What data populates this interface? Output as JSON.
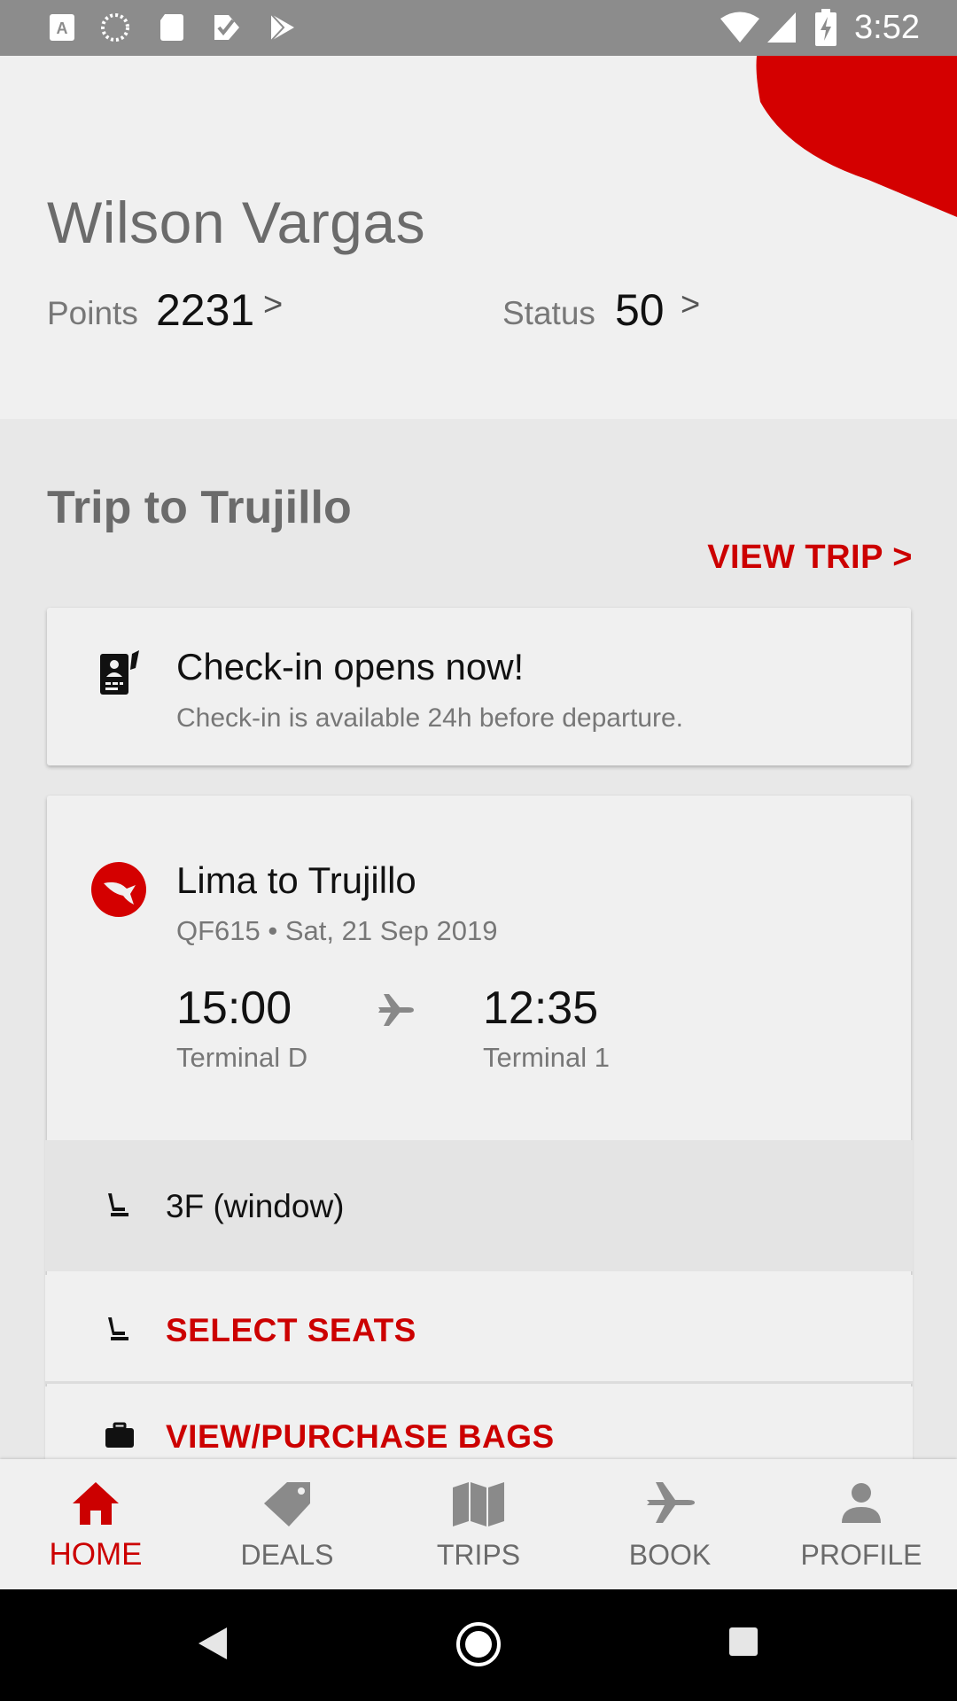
{
  "status_bar": {
    "time": "3:52",
    "left_icons": [
      "a-text-icon",
      "loading-circle-icon",
      "sd-card-icon",
      "check-tag-icon",
      "play-store-icon"
    ],
    "right_icons": [
      "wifi-icon",
      "signal-icon",
      "battery-charging-icon"
    ]
  },
  "profile": {
    "name": "Wilson Vargas",
    "points_label": "Points",
    "points_value": "2231",
    "status_label": "Status",
    "status_value": "50",
    "chevron": ">"
  },
  "trip": {
    "title": "Trip to Trujillo",
    "view_trip_label": "VIEW TRIP  >"
  },
  "checkin": {
    "title": "Check-in opens now!",
    "subtitle": "Check-in is available 24h before departure."
  },
  "flight": {
    "route": "Lima to Trujillo",
    "meta": "QF615 • Sat, 21 Sep 2019",
    "depart_time": "15:00",
    "depart_terminal": "Terminal D",
    "arrive_time": "12:35",
    "arrive_terminal": "Terminal 1",
    "seat": "3F (window)",
    "select_seats_label": "SELECT SEATS",
    "bags_label": "VIEW/PURCHASE BAGS"
  },
  "bottom_nav": {
    "items": [
      {
        "label": "HOME",
        "icon": "home-icon",
        "active": true
      },
      {
        "label": "DEALS",
        "icon": "tag-icon",
        "active": false
      },
      {
        "label": "TRIPS",
        "icon": "map-icon",
        "active": false
      },
      {
        "label": "BOOK",
        "icon": "plane-icon",
        "active": false
      },
      {
        "label": "PROFILE",
        "icon": "person-icon",
        "active": false
      }
    ]
  },
  "colors": {
    "accent_red": "#cc0000",
    "logo_red": "#d40000",
    "status_bar": "#8c8c8c",
    "background": "#e8e8e8",
    "card": "#f0f0f0",
    "text_muted": "#777777"
  }
}
